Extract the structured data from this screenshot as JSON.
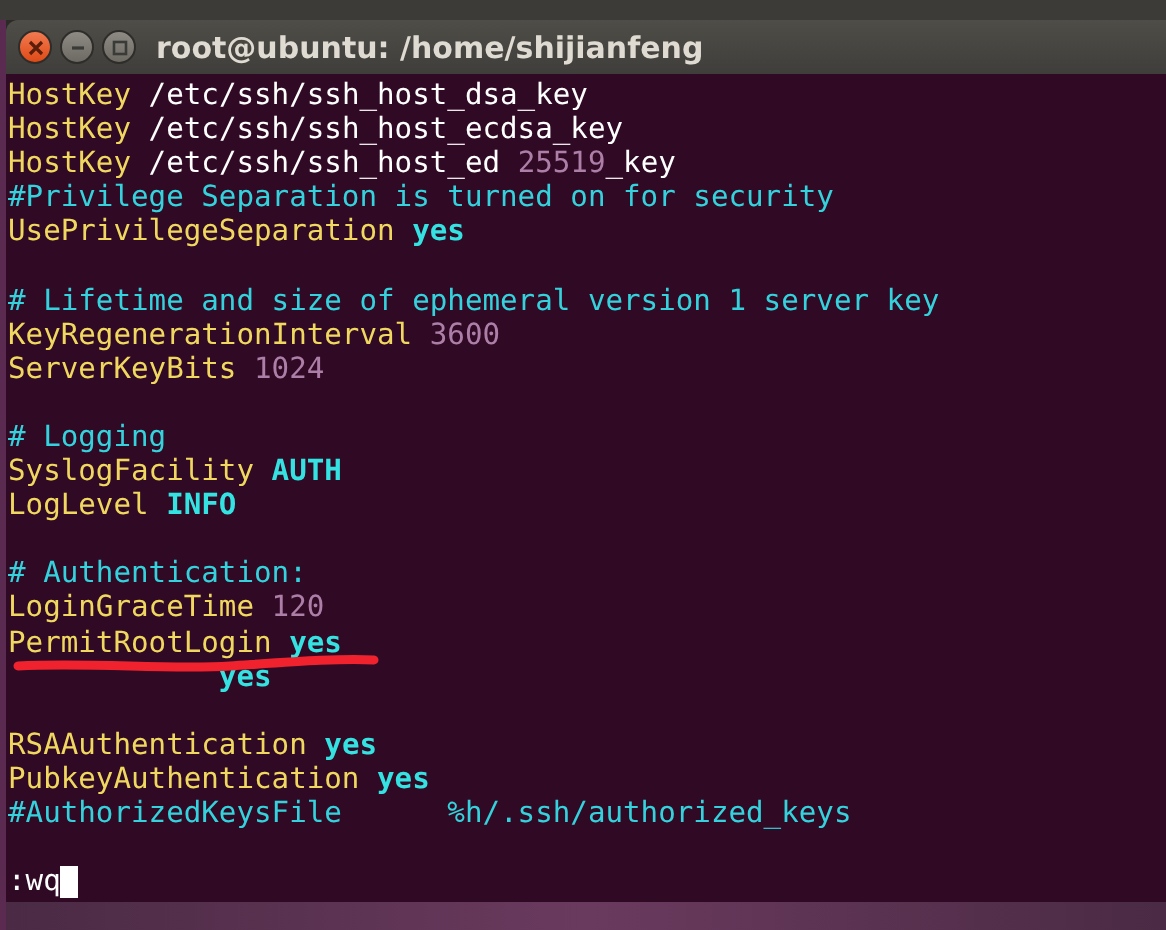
{
  "window": {
    "title": "root@ubuntu: /home/shijianfeng"
  },
  "lines": [
    {
      "kind": "code",
      "segments": [
        {
          "kind": "key",
          "text": "HostKey"
        },
        {
          "kind": "value",
          "text": " /etc/ssh/ssh_host_dsa_key"
        }
      ]
    },
    {
      "kind": "code",
      "segments": [
        {
          "kind": "key",
          "text": "HostKey"
        },
        {
          "kind": "value",
          "text": " /etc/ssh/ssh_host_ecdsa_key"
        }
      ]
    },
    {
      "kind": "code",
      "segments": [
        {
          "kind": "key",
          "text": "HostKey"
        },
        {
          "kind": "value",
          "text": " /etc/ssh/ssh_host_ed"
        },
        {
          "kind": "number",
          "text": "25519"
        },
        {
          "kind": "value",
          "text": "_key"
        }
      ]
    },
    {
      "kind": "code",
      "segments": [
        {
          "kind": "comment",
          "text": "#Privilege Separation is turned on for security"
        }
      ]
    },
    {
      "kind": "code",
      "segments": [
        {
          "kind": "key",
          "text": "UsePrivilegeSeparation"
        },
        {
          "kind": "keyword",
          "text": "yes"
        }
      ]
    },
    {
      "kind": "blank"
    },
    {
      "kind": "code",
      "segments": [
        {
          "kind": "comment",
          "text": "# Lifetime and size of ephemeral version 1 server key"
        }
      ]
    },
    {
      "kind": "code",
      "segments": [
        {
          "kind": "key",
          "text": "KeyRegenerationInterval"
        },
        {
          "kind": "number",
          "text": "3600"
        }
      ]
    },
    {
      "kind": "code",
      "segments": [
        {
          "kind": "key",
          "text": "ServerKeyBits"
        },
        {
          "kind": "number",
          "text": "1024"
        }
      ]
    },
    {
      "kind": "blank"
    },
    {
      "kind": "code",
      "segments": [
        {
          "kind": "comment",
          "text": "# Logging"
        }
      ]
    },
    {
      "kind": "code",
      "segments": [
        {
          "kind": "key",
          "text": "SyslogFacility"
        },
        {
          "kind": "keyword",
          "text": "AUTH"
        }
      ]
    },
    {
      "kind": "code",
      "segments": [
        {
          "kind": "key",
          "text": "LogLevel"
        },
        {
          "kind": "keyword",
          "text": "INFO"
        }
      ]
    },
    {
      "kind": "blank"
    },
    {
      "kind": "code",
      "segments": [
        {
          "kind": "comment",
          "text": "# Authentication:"
        }
      ]
    },
    {
      "kind": "code",
      "segments": [
        {
          "kind": "key",
          "text": "LoginGraceTime"
        },
        {
          "kind": "number",
          "text": "120"
        }
      ]
    },
    {
      "kind": "code",
      "segments": [
        {
          "kind": "key",
          "text": "PermitRootLogin"
        },
        {
          "kind": "keyword",
          "text": "yes"
        }
      ]
    },
    {
      "kind": "code",
      "obscured_start": true,
      "segments": [
        {
          "kind": "keyword",
          "text": "yes"
        }
      ]
    },
    {
      "kind": "blank"
    },
    {
      "kind": "code",
      "segments": [
        {
          "kind": "key",
          "text": "RSAAuthentication"
        },
        {
          "kind": "keyword",
          "text": "yes"
        }
      ]
    },
    {
      "kind": "code",
      "segments": [
        {
          "kind": "key",
          "text": "PubkeyAuthentication"
        },
        {
          "kind": "keyword",
          "text": "yes"
        }
      ]
    },
    {
      "kind": "code",
      "segments": [
        {
          "kind": "comment",
          "text": "#AuthorizedKeysFile      %h/.ssh/authorized_keys"
        }
      ]
    },
    {
      "kind": "blank"
    },
    {
      "kind": "command",
      "text": ":wq"
    }
  ]
}
